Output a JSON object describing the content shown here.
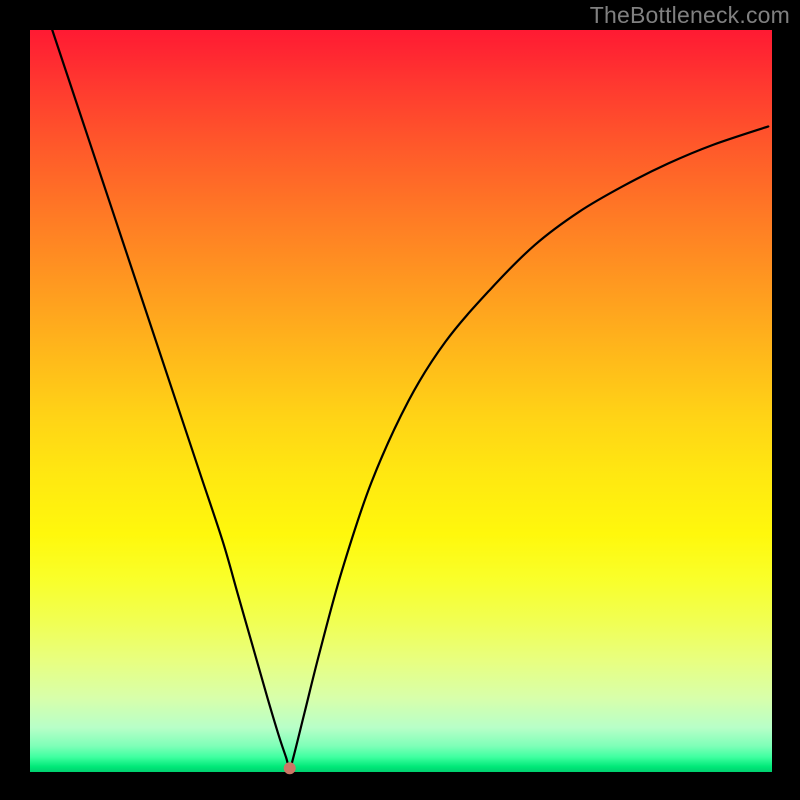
{
  "watermark": "TheBottleneck.com",
  "colors": {
    "frame_bg": "#000000",
    "gradient_top": "#ff1a33",
    "gradient_mid": "#ffe811",
    "gradient_bottom": "#00d070",
    "curve_stroke": "#000000",
    "dot_fill": "#cc7766"
  },
  "chart_data": {
    "type": "line",
    "title": "",
    "xlabel": "",
    "ylabel": "",
    "xlim": [
      0,
      100
    ],
    "ylim": [
      0,
      100
    ],
    "series": [
      {
        "name": "bottleneck-curve",
        "x": [
          3,
          5,
          8,
          11,
          14,
          17,
          20,
          23,
          26,
          28,
          30,
          32,
          33.5,
          34.5,
          35,
          35.5,
          37,
          39,
          42,
          46,
          51,
          56,
          62,
          68,
          74,
          80,
          86,
          92,
          99.5
        ],
        "y": [
          100,
          94,
          85,
          76,
          67,
          58,
          49,
          40,
          31,
          24,
          17,
          10,
          5,
          2,
          0.5,
          2,
          8,
          16,
          27,
          39,
          50,
          58,
          65,
          71,
          75.5,
          79,
          82,
          84.5,
          87
        ]
      }
    ],
    "annotations": [
      {
        "name": "minimum-point",
        "x": 35,
        "y": 0.5
      }
    ]
  }
}
